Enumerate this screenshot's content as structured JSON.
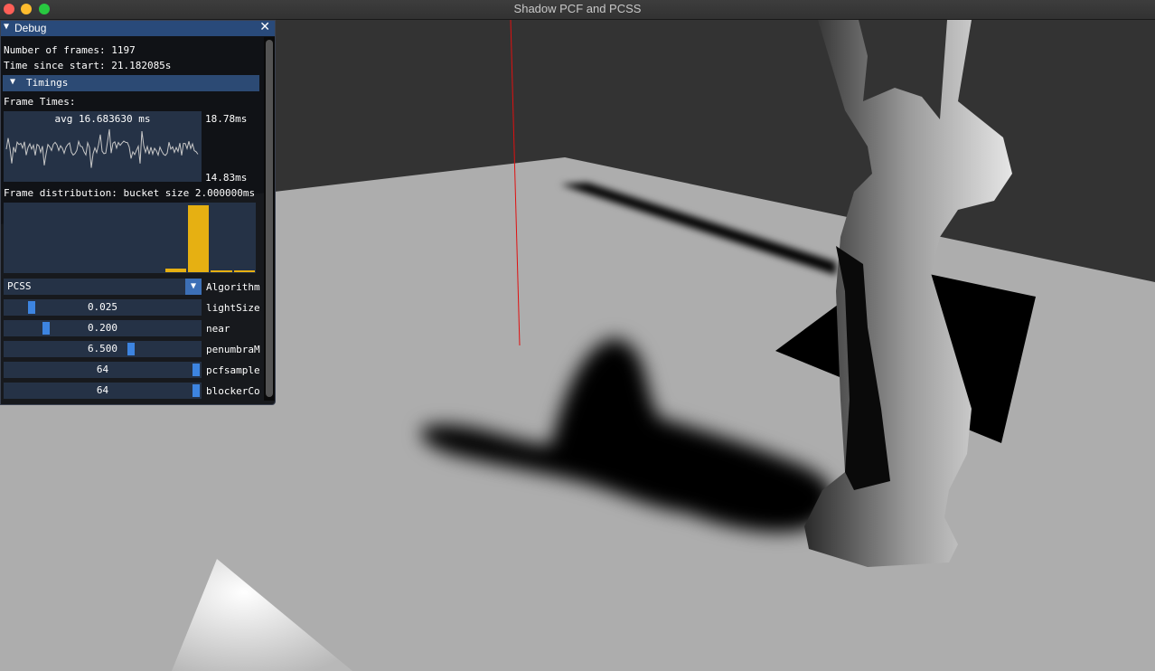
{
  "window": {
    "title": "Shadow PCF and PCSS"
  },
  "debug_panel": {
    "title": "Debug",
    "frames_line": "Number of frames: 1197",
    "time_line": "Time since start: 21.182085s",
    "timings_header": "Timings",
    "frame_times_label": "Frame Times:",
    "plot_overlay": "avg 16.683630 ms",
    "plot_max": "18.78ms",
    "plot_min": "14.83ms",
    "distribution_label": "Frame distribution: bucket size 2.000000ms",
    "histogram_values": [
      0,
      0,
      0,
      0,
      0,
      0,
      0,
      0.05,
      1.0,
      0.03,
      0.03
    ],
    "algorithm": {
      "value": "PCSS",
      "label": "Algorithm"
    },
    "sliders": [
      {
        "value": "0.025",
        "label": "lightSize",
        "fraction": 0.12
      },
      {
        "value": "0.200",
        "label": "near",
        "fraction": 0.2
      },
      {
        "value": "6.500",
        "label": "penumbraM",
        "fraction": 0.65
      },
      {
        "value": "64",
        "label": "pcfsample",
        "fraction": 1.0
      },
      {
        "value": "64",
        "label": "blockerCo",
        "fraction": 1.0
      }
    ],
    "colors": {
      "header": "#294a7a",
      "histogram": "#e6b012",
      "grab": "#3d84e0"
    }
  }
}
